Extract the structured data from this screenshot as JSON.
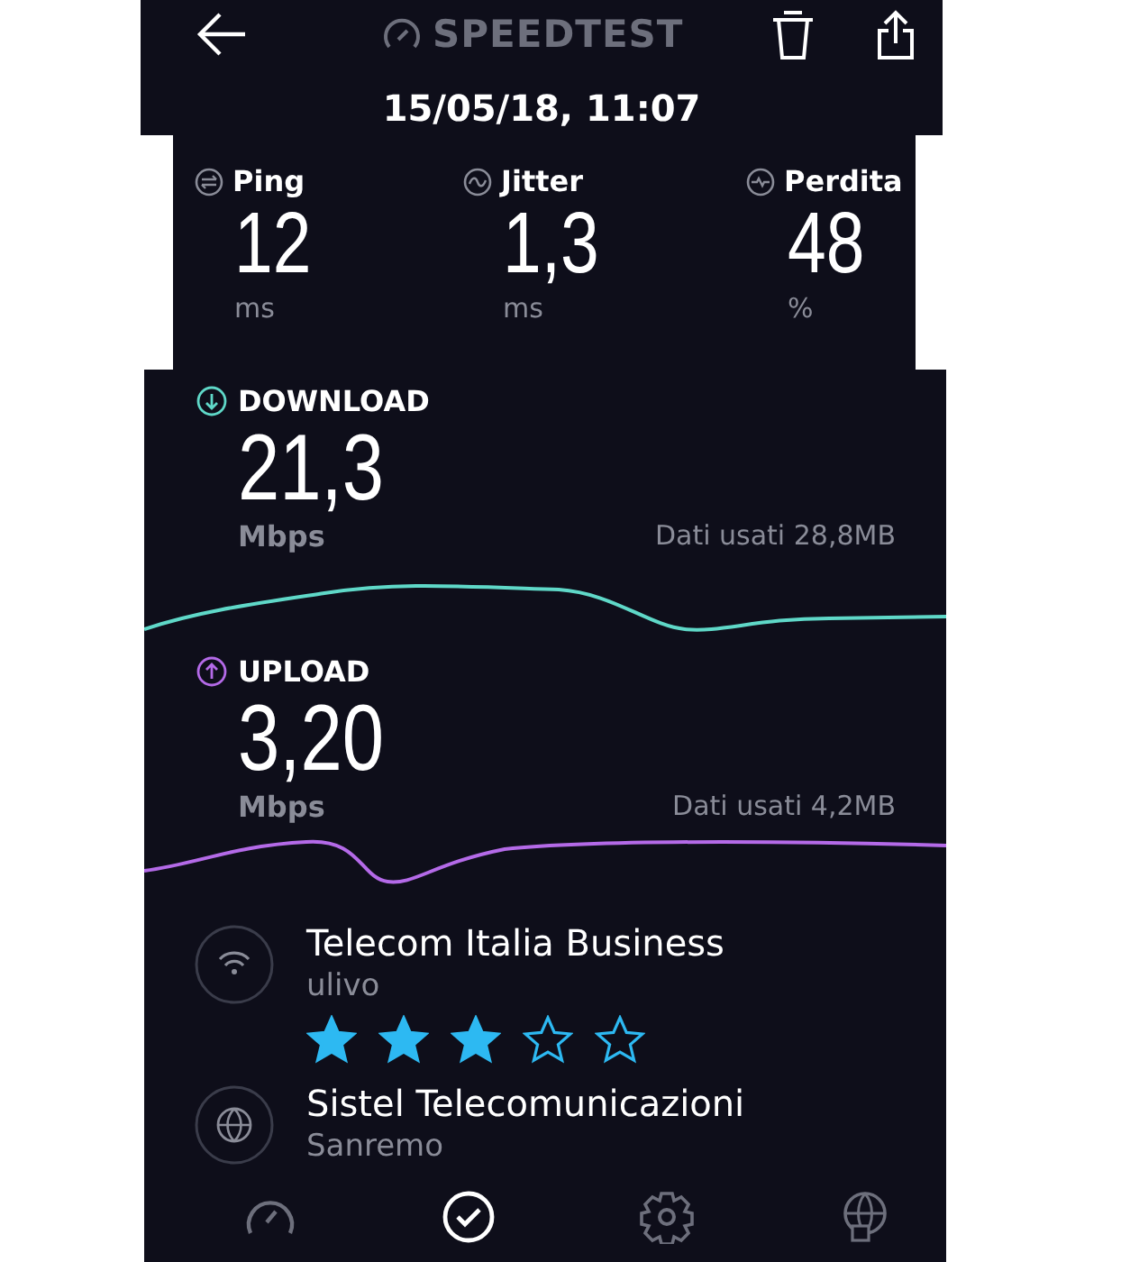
{
  "header": {
    "title": "SPEEDTEST",
    "datetime": "15/05/18, 11:07"
  },
  "metrics": [
    {
      "kind": "ping",
      "label": "Ping",
      "value": "12",
      "unit": "ms"
    },
    {
      "kind": "jitter",
      "label": "Jitter",
      "value": "1,3",
      "unit": "ms"
    },
    {
      "kind": "loss",
      "label": "Perdita",
      "value": "48",
      "unit": "%"
    }
  ],
  "speeds": [
    {
      "kind": "download",
      "label": "DOWNLOAD",
      "value": "21,3",
      "unit": "Mbps",
      "data_used": "Dati usati 28,8MB",
      "color": "#5fd8c8"
    },
    {
      "kind": "upload",
      "label": "UPLOAD",
      "value": "3,20",
      "unit": "Mbps",
      "data_used": "Dati usati 4,2MB",
      "color": "#b46ae8"
    }
  ],
  "connections": [
    {
      "kind": "provider",
      "name": "Telecom Italia Business",
      "detail": "ulivo",
      "stars": 3
    },
    {
      "kind": "server",
      "name": "Sistel Telecomunicazioni",
      "detail": "Sanremo"
    }
  ],
  "nav": [
    {
      "kind": "speed",
      "selected": false
    },
    {
      "kind": "results",
      "selected": true
    },
    {
      "kind": "settings",
      "selected": false
    },
    {
      "kind": "vpn",
      "selected": false
    }
  ]
}
